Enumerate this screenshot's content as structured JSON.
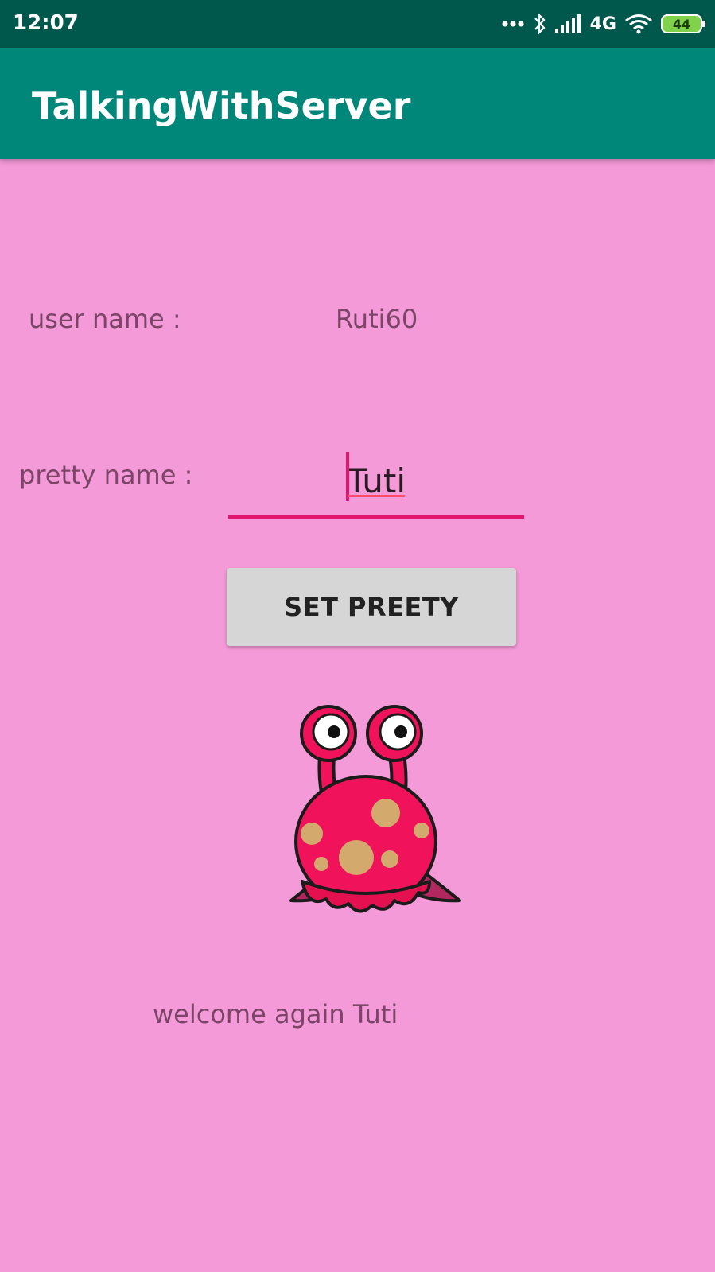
{
  "status_bar": {
    "time": "12:07",
    "network": "4G",
    "battery": "44"
  },
  "app_bar": {
    "title": "TalkingWithServer"
  },
  "form": {
    "user_name_label": "user name :",
    "user_name_value": "Ruti60",
    "pretty_name_label": "pretty name :",
    "pretty_name_value": "Tuti",
    "set_button_label": "SET PREETY"
  },
  "welcome_message": "welcome again Tuti",
  "colors": {
    "status_bar": "#00574c",
    "app_bar": "#00877a",
    "background": "#f59ad8",
    "accent": "#e1176f",
    "button": "#d6d6d6"
  },
  "icons": [
    "more-dots-icon",
    "bluetooth-icon",
    "signal-icon",
    "wifi-icon",
    "battery-icon",
    "monster-image"
  ]
}
